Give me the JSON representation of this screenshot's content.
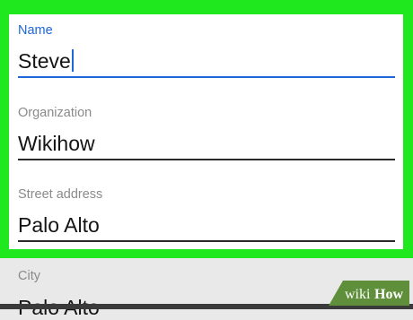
{
  "form": {
    "fields": [
      {
        "label": "Name",
        "value": "Steve",
        "focused": true
      },
      {
        "label": "Organization",
        "value": "Wikihow",
        "focused": false
      },
      {
        "label": "Street address",
        "value": "Palo Alto",
        "focused": false
      },
      {
        "label": "City",
        "value": "Palo Alto",
        "focused": false
      }
    ]
  },
  "watermark": {
    "text_wiki": "wiki",
    "text_how": "How"
  },
  "colors": {
    "highlight": "#1fe81f",
    "accent": "#1f67d6",
    "background": "#e9e9e9"
  }
}
